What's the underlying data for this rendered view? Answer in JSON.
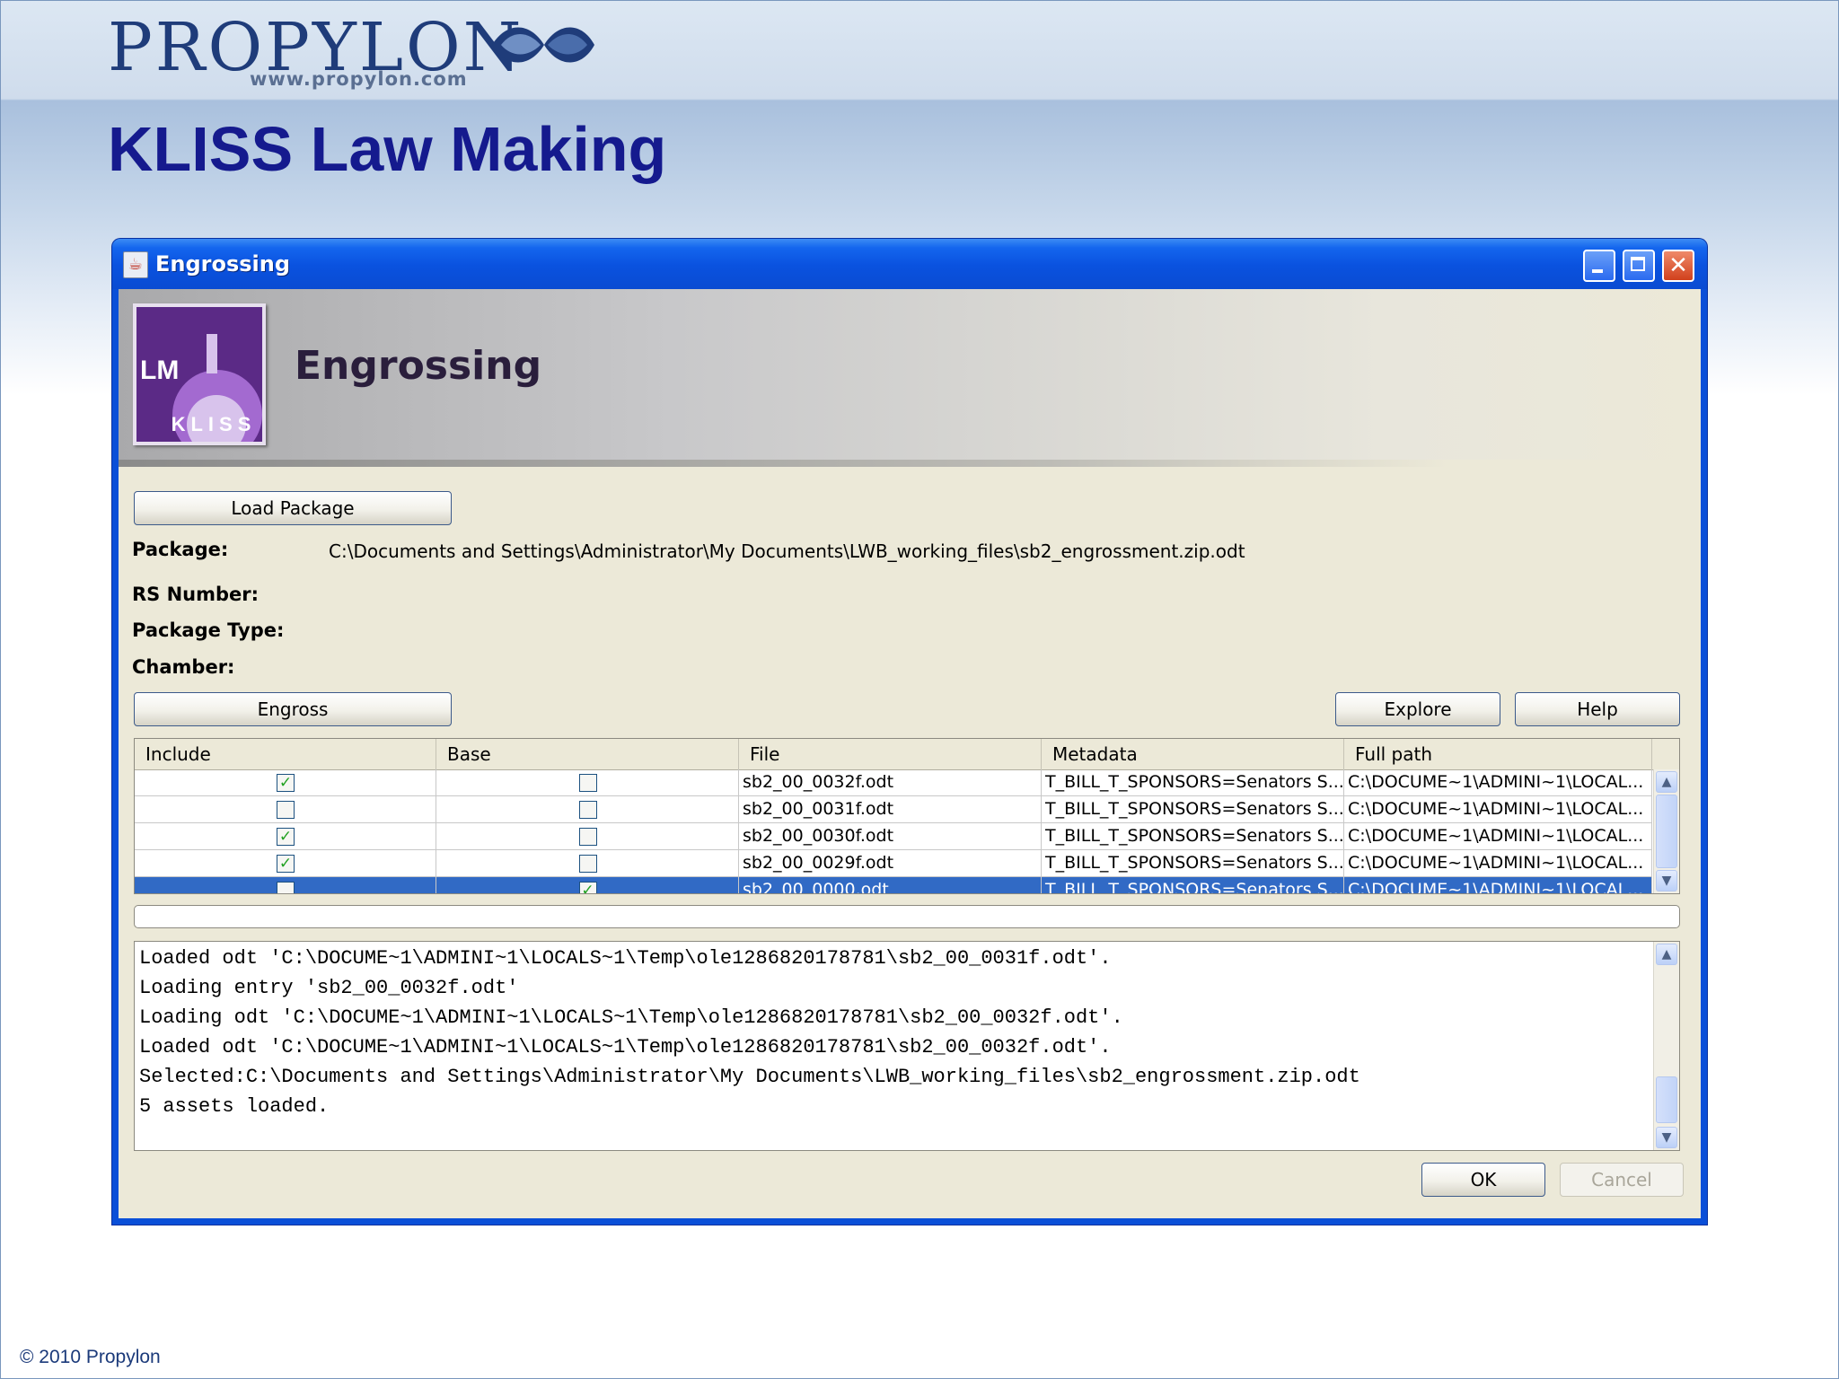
{
  "slide": {
    "brand": "PROPYLON",
    "brand_url": "www.propylon.com",
    "title": "KLISS Law Making",
    "footer": "© 2010 Propylon"
  },
  "window": {
    "title": "Engrossing",
    "banner_title": "Engrossing",
    "logo_text": "LM",
    "logo_ring_text": "KLISS"
  },
  "form": {
    "load_button": "Load Package",
    "package_label": "Package:",
    "package_value": "C:\\Documents and Settings\\Administrator\\My Documents\\LWB_working_files\\sb2_engrossment.zip.odt",
    "rs_number_label": "RS Number:",
    "package_type_label": "Package Type:",
    "chamber_label": "Chamber:",
    "engross_button": "Engross",
    "explore_button": "Explore",
    "help_button": "Help"
  },
  "table": {
    "columns": [
      "Include",
      "Base",
      "File",
      "Metadata",
      "Full path"
    ],
    "rows": [
      {
        "include": true,
        "base": false,
        "file": "sb2_00_0032f.odt",
        "metadata": "T_BILL_T_SPONSORS=Senators S...",
        "path": "C:\\DOCUME~1\\ADMINI~1\\LOCAL...",
        "selected": false
      },
      {
        "include": false,
        "base": false,
        "file": "sb2_00_0031f.odt",
        "metadata": "T_BILL_T_SPONSORS=Senators S...",
        "path": "C:\\DOCUME~1\\ADMINI~1\\LOCAL...",
        "selected": false
      },
      {
        "include": true,
        "base": false,
        "file": "sb2_00_0030f.odt",
        "metadata": "T_BILL_T_SPONSORS=Senators S...",
        "path": "C:\\DOCUME~1\\ADMINI~1\\LOCAL...",
        "selected": false
      },
      {
        "include": true,
        "base": false,
        "file": "sb2_00_0029f.odt",
        "metadata": "T_BILL_T_SPONSORS=Senators S...",
        "path": "C:\\DOCUME~1\\ADMINI~1\\LOCAL...",
        "selected": false
      },
      {
        "include": false,
        "base": true,
        "file": "sb2_00_0000.odt",
        "metadata": "T_BILL_T_SPONSORS=Senators S...",
        "path": "C:\\DOCUME~1\\ADMINI~1\\LOCAL...",
        "selected": true
      }
    ]
  },
  "progress": {
    "value": 0
  },
  "log": {
    "lines": [
      "Loaded odt 'C:\\DOCUME~1\\ADMINI~1\\LOCALS~1\\Temp\\ole1286820178781\\sb2_00_0031f.odt'.",
      "Loading entry 'sb2_00_0032f.odt'",
      "Loading odt 'C:\\DOCUME~1\\ADMINI~1\\LOCALS~1\\Temp\\ole1286820178781\\sb2_00_0032f.odt'.",
      "Loaded odt 'C:\\DOCUME~1\\ADMINI~1\\LOCALS~1\\Temp\\ole1286820178781\\sb2_00_0032f.odt'.",
      "Selected:C:\\Documents and Settings\\Administrator\\My Documents\\LWB_working_files\\sb2_engrossment.zip.odt",
      "5 assets loaded."
    ]
  },
  "dialog": {
    "ok_button": "OK",
    "cancel_button": "Cancel"
  },
  "colors": {
    "title_blue": "#151a8e",
    "titlebar_blue": "#0a52df",
    "selection_blue": "#316ac5",
    "check_green": "#21a121",
    "logo_purple": "#5b2a86"
  },
  "icons": {
    "window_icon": "java-cup-icon",
    "brand_logo": "propylon-ribbon-logo",
    "check": "checkmark-icon"
  }
}
